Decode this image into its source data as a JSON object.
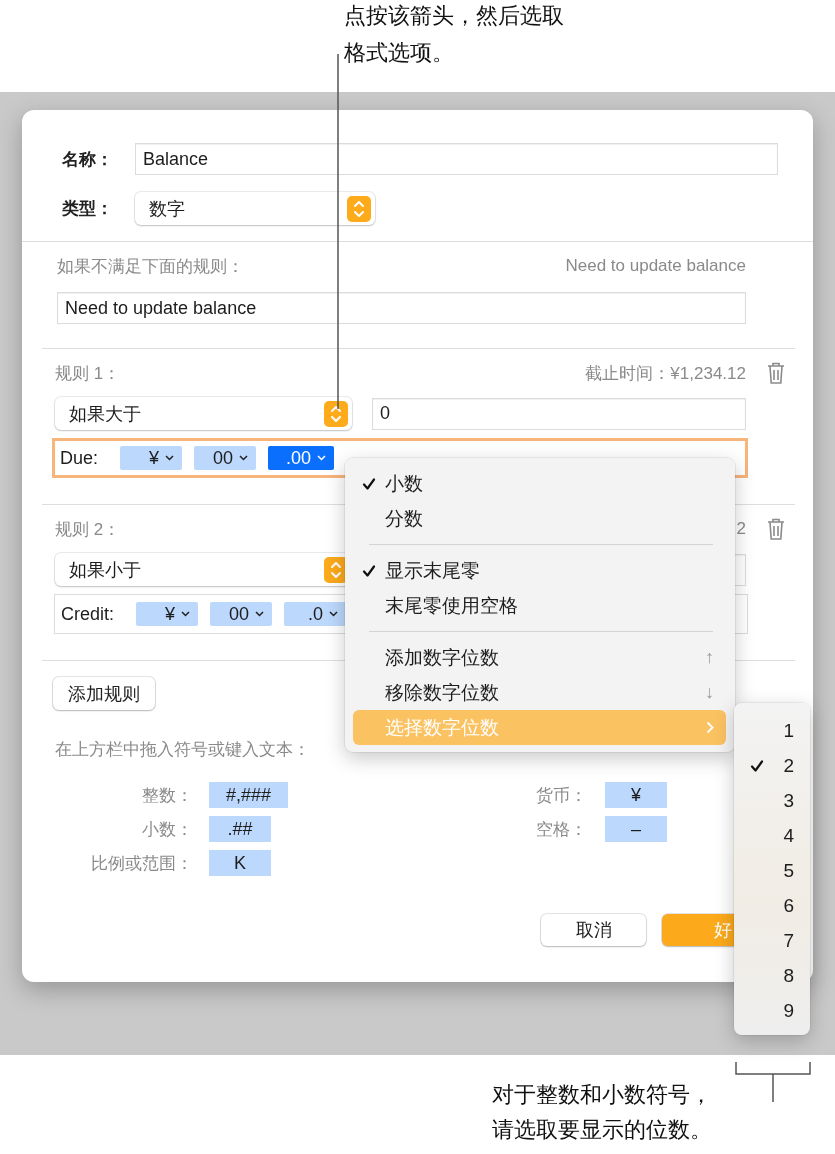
{
  "callouts": [
    {
      "text": "点按该箭头，然后选取格式选项。",
      "kind": "top"
    },
    {
      "text": "对于整数和小数符号，请选取要显示的位数。",
      "kind": "bottom"
    }
  ],
  "dialog": {
    "name_label": "名称：",
    "name_value": "Balance",
    "type_label": "类型：",
    "type_value": "数字",
    "fallback_label": "如果不满足下面的规则：",
    "fallback_preview": "Need to update balance",
    "fallback_value": "Need to update balance",
    "rules": [
      {
        "title": "规则 1：",
        "preview": "截止时间：¥1,234.12",
        "condition": "如果大于",
        "value": "0",
        "format_label": "Due:",
        "focused": true,
        "tokens": [
          {
            "text": "¥",
            "selected": false
          },
          {
            "text": "00",
            "selected": false
          },
          {
            "text": ".00",
            "selected": true
          }
        ]
      },
      {
        "title": "规则 2：",
        "preview": "2",
        "condition": "如果小于",
        "format_label": "Credit:",
        "focused": false,
        "tokens": [
          {
            "text": "¥",
            "selected": false
          },
          {
            "text": "00",
            "selected": false
          },
          {
            "text": ".0",
            "selected": false
          }
        ]
      }
    ],
    "add_rule_button": "添加规则",
    "hint": "在上方栏中拖入符号或键入文本：",
    "palette_left": [
      {
        "label": "整数：",
        "token": "#,###"
      },
      {
        "label": "小数：",
        "token": ".##"
      },
      {
        "label": "比例或范围：",
        "token": "K"
      }
    ],
    "palette_right": [
      {
        "label": "货币：",
        "token": "¥"
      },
      {
        "label": "空格：",
        "token": "–"
      }
    ],
    "buttons": [
      {
        "label": "取消",
        "kind": "normal"
      },
      {
        "label": "好",
        "kind": "default"
      }
    ]
  },
  "menu": {
    "items": [
      {
        "kind": "item",
        "label": "小数",
        "checked": true,
        "selected": false
      },
      {
        "kind": "item",
        "label": "分数",
        "checked": false,
        "selected": false
      },
      {
        "kind": "separator"
      },
      {
        "kind": "item",
        "label": "显示末尾零",
        "checked": true,
        "selected": false
      },
      {
        "kind": "item",
        "label": "末尾零使用空格",
        "checked": false,
        "selected": false
      },
      {
        "kind": "separator"
      },
      {
        "kind": "item",
        "label": "添加数字位数",
        "checked": false,
        "selected": false,
        "shortcut": "↑"
      },
      {
        "kind": "item",
        "label": "移除数字位数",
        "checked": false,
        "selected": false,
        "shortcut": "↓"
      },
      {
        "kind": "submenu",
        "label": "选择数字位数",
        "checked": false,
        "selected": true
      }
    ]
  },
  "submenu": {
    "items": [
      {
        "label": "1",
        "checked": false
      },
      {
        "label": "2",
        "checked": true
      },
      {
        "label": "3",
        "checked": false
      },
      {
        "label": "4",
        "checked": false
      },
      {
        "label": "5",
        "checked": false
      },
      {
        "label": "6",
        "checked": false
      },
      {
        "label": "7",
        "checked": false
      },
      {
        "label": "8",
        "checked": false
      },
      {
        "label": "9",
        "checked": false
      }
    ]
  }
}
